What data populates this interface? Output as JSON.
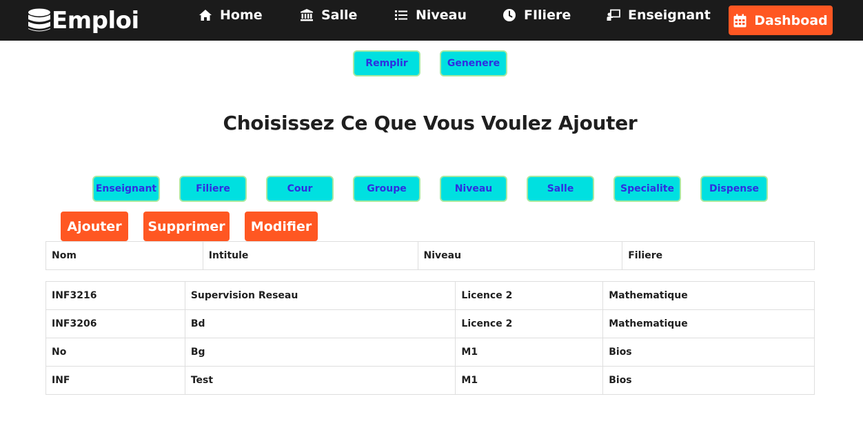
{
  "brand": {
    "name": "Emploi",
    "icon": "database-icon"
  },
  "nav": {
    "home": {
      "label": "Home",
      "icon": "home-icon"
    },
    "salle": {
      "label": "Salle",
      "icon": "institution-icon"
    },
    "niveau": {
      "label": "Niveau",
      "icon": "list-icon"
    },
    "filiere": {
      "label": "FIliere",
      "icon": "clock-icon"
    },
    "enseignant": {
      "label": "Enseignant",
      "icon": "chalkboard-teacher-icon"
    },
    "dashboard": {
      "label": "Dashboad",
      "icon": "calendar-icon"
    }
  },
  "actions_top": {
    "remplir": "Remplir",
    "genenere": "Genenere"
  },
  "page_title": "Choisissez Ce Que Vous Voulez Ajouter",
  "categories": [
    "Enseignant",
    "Filiere",
    "Cour",
    "Groupe",
    "Niveau",
    "Salle",
    "Specialite",
    "Dispense"
  ],
  "crud": {
    "ajouter": "Ajouter",
    "supprimer": "Supprimer",
    "modifier": "Modifier"
  },
  "table": {
    "headers": [
      "Nom",
      "Intitule",
      "Niveau",
      "Filiere"
    ],
    "rows": [
      [
        "INF3216",
        "Supervision Reseau",
        "Licence 2",
        "Mathematique"
      ],
      [
        "INF3206",
        "Bd",
        "Licence 2",
        "Mathematique"
      ],
      [
        "No",
        "Bg",
        "M1",
        "Bios"
      ],
      [
        "INF",
        "Test",
        "M1",
        "Bios"
      ]
    ]
  },
  "colors": {
    "navbar": "#1b1b1b",
    "accent_orange": "#ff5722",
    "cyan": "#00e0e0",
    "cyan_border": "#a8e9a0",
    "cyan_text": "#2f2fe0"
  }
}
